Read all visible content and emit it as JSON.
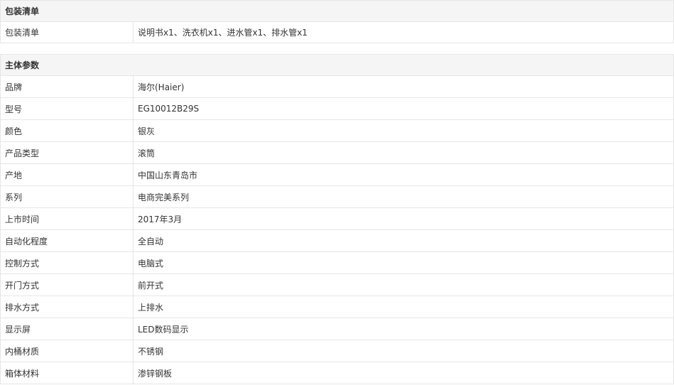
{
  "sections": [
    {
      "title": "包装清单",
      "rows": [
        {
          "label": "包装清单",
          "value": "说明书x1、洗衣机x1、进水管x1、排水管x1"
        }
      ]
    },
    {
      "title": "主体参数",
      "rows": [
        {
          "label": "品牌",
          "value": "海尔(Haier)"
        },
        {
          "label": "型号",
          "value": "EG10012B29S"
        },
        {
          "label": "颜色",
          "value": "银灰"
        },
        {
          "label": "产品类型",
          "value": "滚筒"
        },
        {
          "label": "产地",
          "value": "中国山东青岛市"
        },
        {
          "label": "系列",
          "value": "电商完美系列"
        },
        {
          "label": "上市时间",
          "value": "2017年3月"
        },
        {
          "label": "自动化程度",
          "value": "全自动"
        },
        {
          "label": "控制方式",
          "value": "电脑式"
        },
        {
          "label": "开门方式",
          "value": "前开式"
        },
        {
          "label": "排水方式",
          "value": "上排水"
        },
        {
          "label": "显示屏",
          "value": "LED数码显示"
        },
        {
          "label": "内桶材质",
          "value": "不锈钢"
        },
        {
          "label": "箱体材料",
          "value": "渗锌钢板"
        }
      ]
    }
  ]
}
